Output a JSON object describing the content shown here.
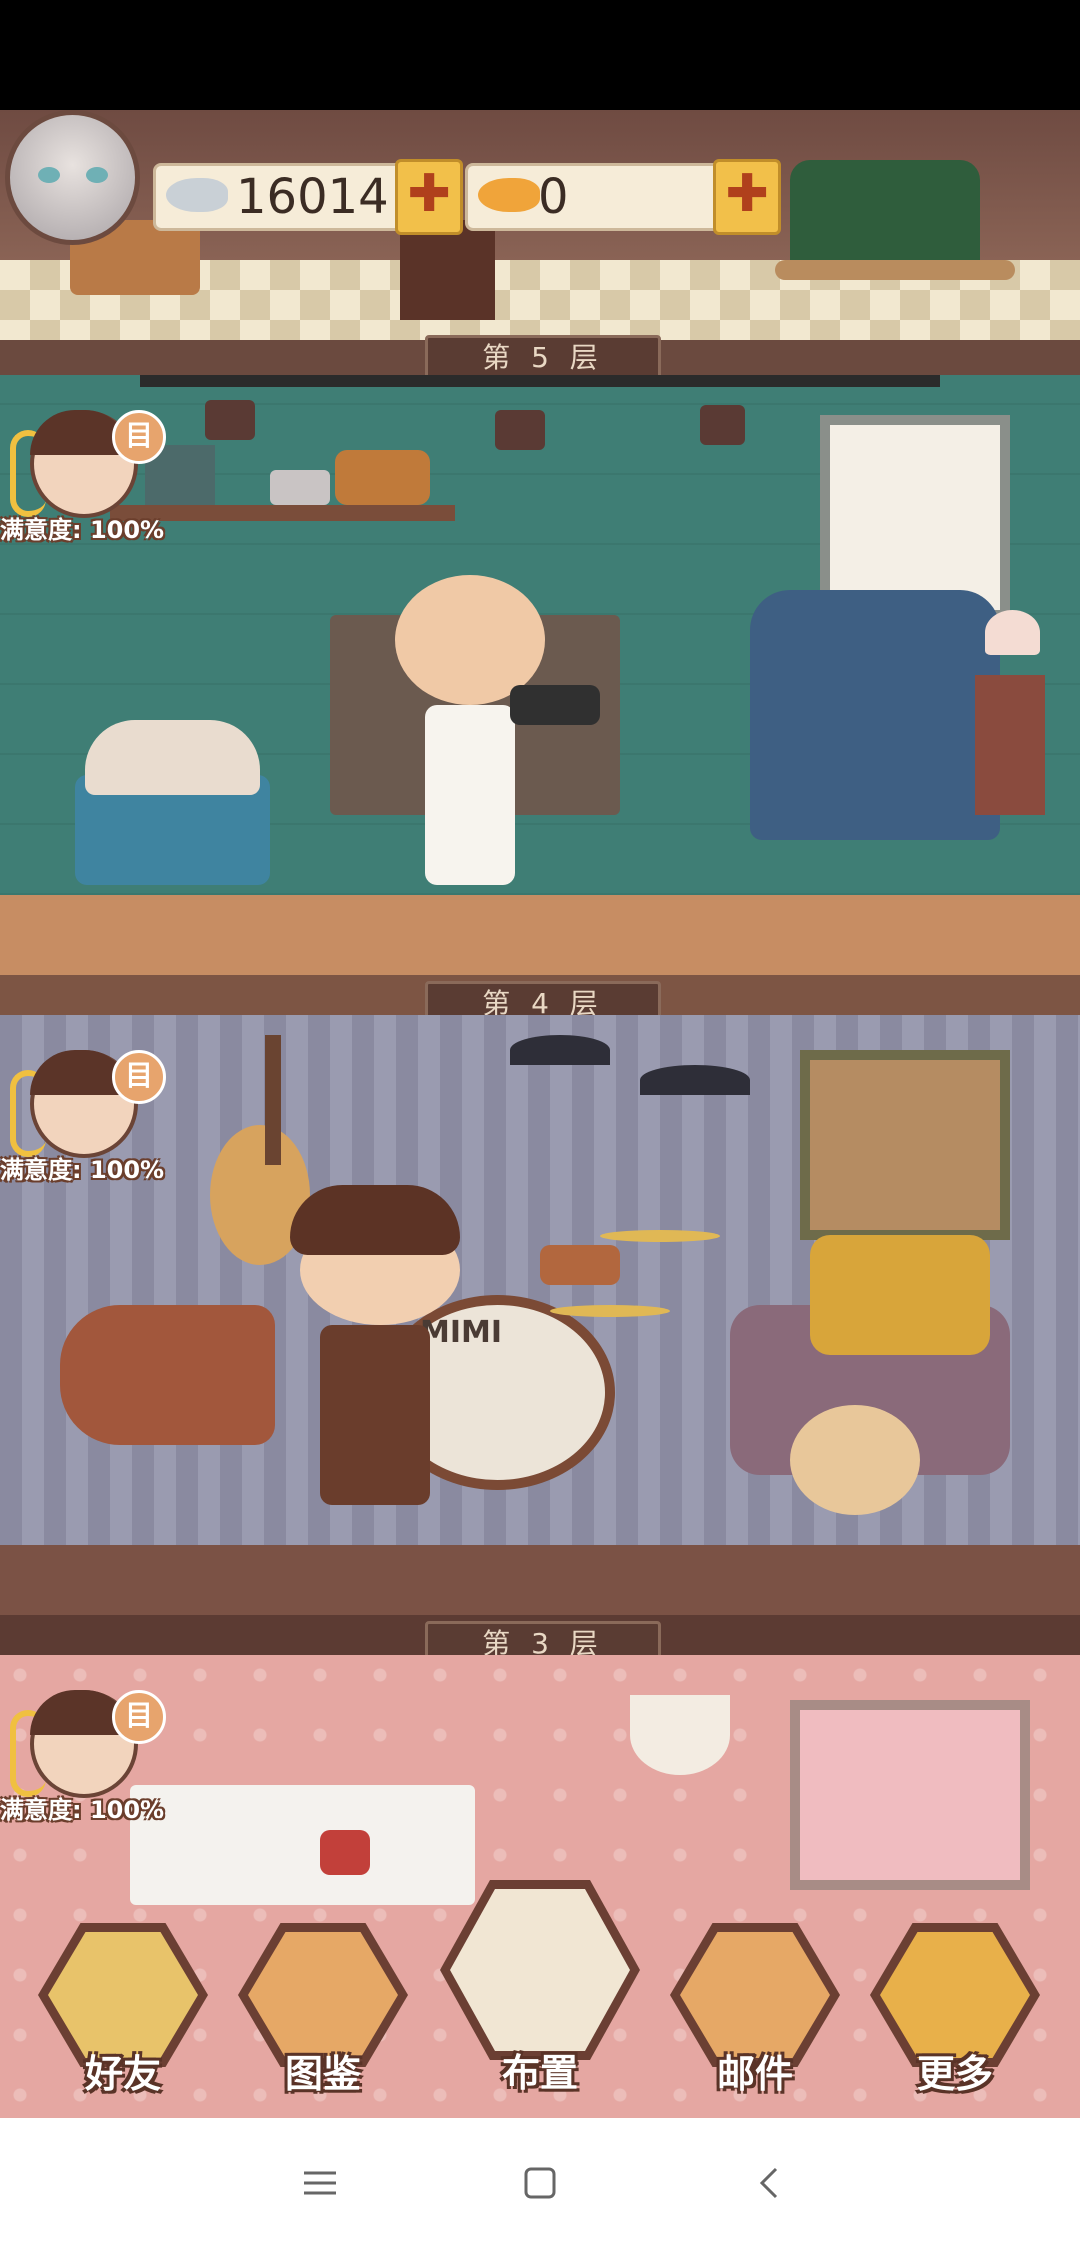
{
  "currency": {
    "silver_fish": "16014",
    "gold_fish": "0",
    "plus": "✚"
  },
  "floors": {
    "floor5": "第 5 层",
    "floor4": "第 4 层",
    "floor3": "第 3 层"
  },
  "residents": [
    {
      "satisfaction": "满意度: 100%",
      "note": "目"
    },
    {
      "satisfaction": "满意度: 100%",
      "note": "目"
    },
    {
      "satisfaction": "满意度: 100%",
      "note": "目"
    }
  ],
  "drum_brand": "MIMI",
  "nav": {
    "friends": "好友",
    "catalog": "图鉴",
    "decorate": "布置",
    "mail": "邮件",
    "more": "更多"
  },
  "system_nav": {
    "menu_icon": "menu-icon",
    "home_icon": "home-icon",
    "back_icon": "back-icon"
  },
  "colors": {
    "floor4_wall": "#3f7e75",
    "floor3_wall": "#9a9bb0",
    "floor2_wall": "#e5a7a2",
    "accent_gold": "#f2c04a"
  }
}
